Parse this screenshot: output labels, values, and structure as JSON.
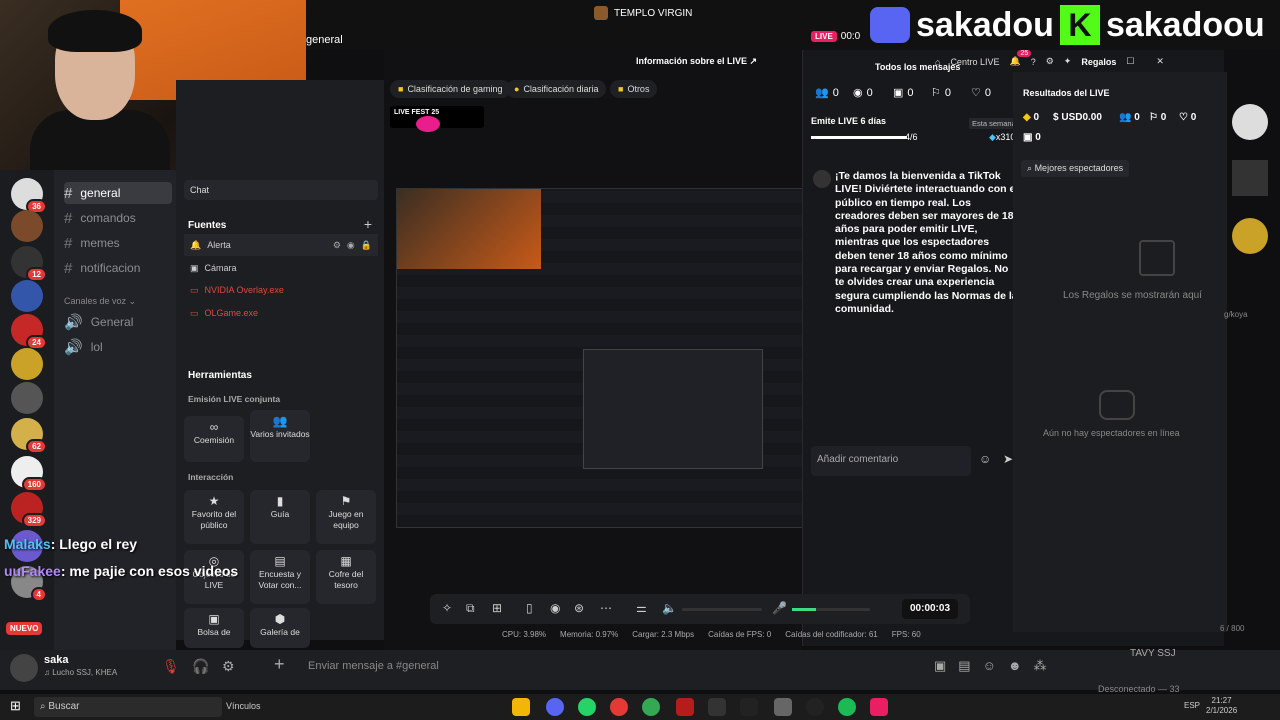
{
  "window_title": "TEMPLO VIRGIN",
  "channel_header": "general",
  "brand": {
    "discord": "sakadou",
    "kick": "sakadoou"
  },
  "servers": [
    {
      "badge": "36"
    },
    {
      "badge": ""
    },
    {
      "badge": "12"
    },
    {
      "badge": ""
    },
    {
      "badge": "24"
    },
    {
      "badge": ""
    },
    {
      "badge": ""
    },
    {
      "badge": "62"
    },
    {
      "badge": "160"
    },
    {
      "badge": "329"
    },
    {
      "badge": ""
    },
    {
      "badge": "4"
    }
  ],
  "servers_new": "NUEVO",
  "channels": {
    "text": [
      {
        "label": "general",
        "selected": true
      },
      {
        "label": "comandos"
      },
      {
        "label": "memes"
      },
      {
        "label": "notificacion"
      }
    ],
    "voice_category": "Canales de voz",
    "voice": [
      {
        "label": "General"
      },
      {
        "label": "lol"
      }
    ]
  },
  "obs": {
    "chat_label": "Chat",
    "sources_title": "Fuentes",
    "sources": [
      {
        "label": "Alerta"
      },
      {
        "label": "Cámara"
      },
      {
        "label": "NVIDIA Overlay.exe"
      },
      {
        "label": "OLGame.exe"
      }
    ],
    "tools_title": "Herramientas",
    "live_joint": "Emisión LIVE conjunta",
    "tool_coemision": "Coemisión",
    "tool_invitados": "Varios invitados",
    "interaction_title": "Interacción",
    "tool_favorito": "Favorito del público",
    "tool_guia": "Guía",
    "tool_juego": "Juego en equipo",
    "tool_objetivo": "Objetivo de LIVE",
    "tool_encuesta": "Encuesta y Votar con...",
    "tool_cofre": "Cofre del tesoro",
    "tool_bolsa": "Bolsa de",
    "tool_galeria": "Galería de"
  },
  "center": {
    "info_title": "Información sobre el LIVE",
    "pill_gaming": "Clasificación de gaming",
    "pill_daily": "Clasificación diaria",
    "pill_other": "Otros",
    "live_fest": "LIVE FEST 25",
    "timer": "00:00:03",
    "stats": {
      "cpu": "CPU: 3.98%",
      "mem": "Memoria: 0.97%",
      "load": "Cargar: 2.3 Mbps",
      "fps_drop": "Caídas de FPS: 0",
      "enc_drop": "Caídas del codificador: 61",
      "fps": "FPS: 60"
    }
  },
  "live_panel": {
    "live_badge": "LIVE",
    "live_time": "00:0",
    "all_messages": "Todos los mensajes",
    "centro_live": "Centro LIVE",
    "notif_count": "25",
    "regalos": "Regalos",
    "counts": [
      "0",
      "0",
      "0",
      "0",
      "0"
    ],
    "streak_title": "Emite LIVE 6 días",
    "streak_week": "Esta semana",
    "streak_progress": "4/6",
    "streak_reward": "x310",
    "welcome": "¡Te damos la bienvenida a TikTok LIVE! Diviértete interactuando con el público en tiempo real. Los creadores deben ser mayores de 18 años para poder emitir LIVE, mientras que los espectadores deben tener 18 años como mínimo para recargar y enviar Regalos. No te olvides crear una experiencia segura cumpliendo las Normas de la comunidad.",
    "comment_placeholder": "Añadir comentario",
    "results_title": "Resultados del LIVE",
    "results": {
      "diamonds": "0",
      "usd": "USD0.00",
      "viewers": "0",
      "follows": "0",
      "likes": "0"
    },
    "results_extra": "0",
    "top_viewers": "Mejores espectadores",
    "gifts_empty": "Los Regalos se mostrarán aquí",
    "viewers_empty": "Aún no hay espectadores en línea"
  },
  "overlay_chat": [
    {
      "user": "Malaks",
      "text": ": Llego el rey"
    },
    {
      "user": "uuFakee",
      "text": ": me pajie con esos videos"
    }
  ],
  "user": {
    "name": "saka",
    "status": "Lucho SSJ, KHEA"
  },
  "message_placeholder": "Enviar mensaje a #general",
  "right_side": {
    "tavy": "TAVY SSJ",
    "disconnected": "Desconectado — 33",
    "koya": "g/koya",
    "count": "6 / 800"
  },
  "taskbar": {
    "search": "Buscar",
    "vinculos": "Vínculos",
    "lang": "ESP",
    "time": "21:27",
    "date": "2/1/2026"
  }
}
